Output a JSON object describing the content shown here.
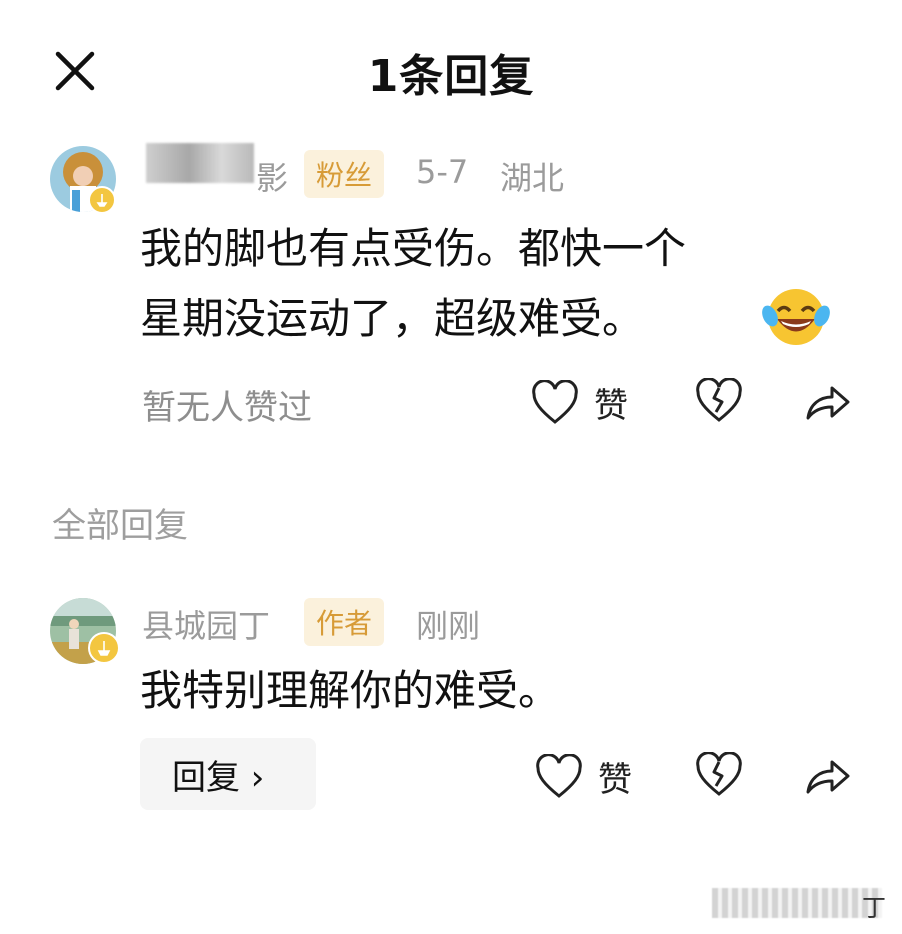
{
  "header": {
    "title": "1条回复"
  },
  "comment": {
    "name_visible": "影",
    "tag": "粉丝",
    "date": "5-7",
    "location": "湖北",
    "text_line1": "我的脚也有点受伤。都快一个",
    "text_line2": "星期没运动了，超级难受。",
    "emoji": "😂",
    "likes_status": "暂无人赞过",
    "like_label": "赞"
  },
  "replies_section": {
    "heading": "全部回复"
  },
  "reply": {
    "name": "县城园丁",
    "tag": "作者",
    "time": "刚刚",
    "text": "我特别理解你的难受。",
    "reply_button": "回复 ›",
    "like_label": "赞"
  },
  "watermark": {
    "text": "丁"
  },
  "colors": {
    "tag_text": "#d79b37",
    "tag_bg": "#fbf1dc",
    "muted": "#9b9b9b",
    "avatar_badge": "#f3c640"
  }
}
